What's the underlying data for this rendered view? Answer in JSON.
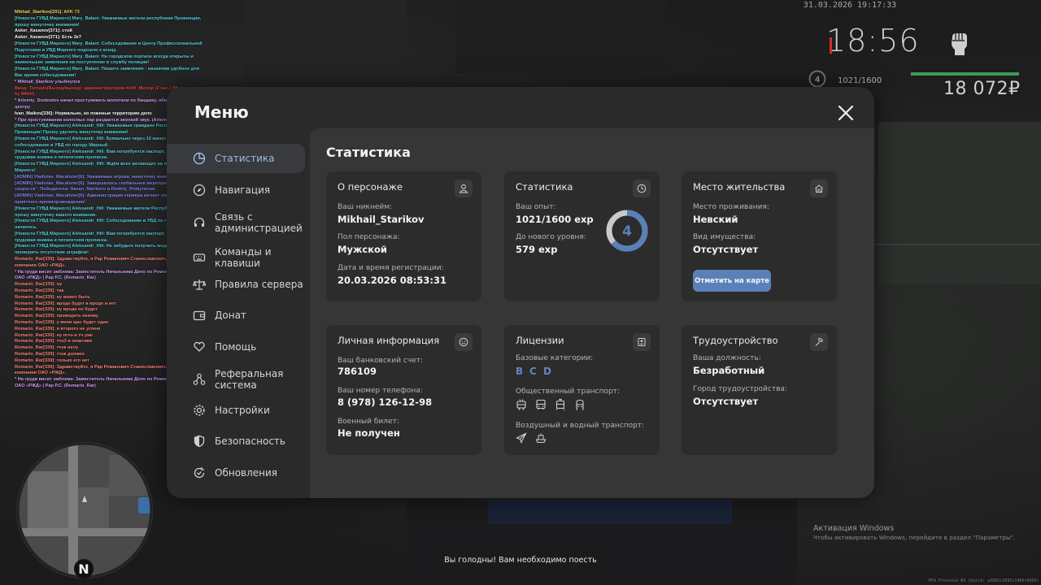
{
  "chat": [
    {
      "text": "Mikhail_Starikov[201]: AFK 73",
      "color": "#e8e05c"
    },
    {
      "text": "[Новости ГУВД Мирного] Mary_Balani: Уважаемые жители республики Провинции, прошу минуточку внимания!",
      "color": "#56d8e6"
    },
    {
      "text": "Asker_Xasanov[371]: стой",
      "color": "#ffffff"
    },
    {
      "text": "Asker_Xasanov[371]: Есть 2к?",
      "color": "#ffffff"
    },
    {
      "text": "[Новости ГУВД Мирного] Mary_Balani: Собеседование в Центр Профессиональной Подготовки в УВД Мирного подошло к концу.",
      "color": "#56d8e6"
    },
    {
      "text": "[Новости ГУВД Мирного] Mary_Balani: На городском портале всегда открыты и наименьшие заявления на поступление в службу полиции!",
      "color": "#56d8e6"
    },
    {
      "text": "[Новости ГУВД Мирного] Mary_Balani: Пишите заявление - назначим удобное для Вас время собеседования!",
      "color": "#56d8e6"
    },
    {
      "text": "* Mikhail_Starikov улыбнулся",
      "color": "#d6a0ff"
    },
    {
      "text": "Ввод: Tornado(Выход/выход): администратором Kirill_Милор (2 час.) (Музыка и идеи by Mikhl)",
      "color": "#e84a4a"
    },
    {
      "text": "* Artemiy_Svobodov начал простукивать молотком по бандажу, ободу, колесно му центру",
      "color": "#d6a0ff"
    },
    {
      "text": "Ivan_Maikov[336]: Нормально, но пожнные территорию депо",
      "color": "#ffffff"
    },
    {
      "text": "* При простукивании колесных пар раздается звонкий звук. (Artemiy_Svobodov)",
      "color": "#d6a0ff"
    },
    {
      "text": "[Новости ГУВД Мирного] Aleksandr_Hill: Уважаемые граждане Республики Провинции! Прошу уделить минуточку внимания!",
      "color": "#56d8e6"
    },
    {
      "text": "[Новости ГУВД Мирного] Aleksandr_Hill: Буквально через 10 минут состоится собеседование в УВД по городу Мирный.",
      "color": "#56d8e6"
    },
    {
      "text": "[Новости ГУВД Мирного] Aleksandr_Hill: Вам потребуется паспорт, военный билет, трудовая книжка и пятилетняя прописка.",
      "color": "#56d8e6"
    },
    {
      "text": "[Новости ГУВД Мирного] Aleksandr_Hill: Ждём всех желающих на парковке УВД Мирного!",
      "color": "#56d8e6"
    },
    {
      "text": "[ADMIN] Vladislav_Macalister[6]: Уважаемые игроки, минуточку внимания!",
      "color": "#8a8aff"
    },
    {
      "text": "[ADMIN] Vladislav_Macalister[6]: Завершилось глобальное мероприятие \"Дыхание скорости\". Победители: Hasan_Marlboro и Dmitriy_Prokyrorow.",
      "color": "#8a8aff"
    },
    {
      "text": "[ADMIN] Vladislav_Macalister[6]: Администрация сервера желает хорошего времени и приятного времяпровождения!",
      "color": "#8a8aff"
    },
    {
      "text": "[Новости ГУВД Мирного] Aleksandr_Hill: Уважаемые жители Республики Провинции, прошу минуточку вашего внимания.",
      "color": "#56d8e6"
    },
    {
      "text": "[Новости ГУВД Мирного] Aleksandr_Hill: Собеседование в УВД по городу Мирный начилось.",
      "color": "#56d8e6"
    },
    {
      "text": "[Новости ГУВД Мирного] Aleksandr_Hill: Вам потребуется паспорт, военный билет, трудовая книжка и пятилетняя прописка.",
      "color": "#56d8e6"
    },
    {
      "text": "[Новости ГУВД Мирного] Aleksandr_Hill: Не забудьте получить медицинскую карту и проверить отсутствие штрафов!",
      "color": "#56d8e6"
    },
    {
      "text": "Romario_Rar[339]: Здравствуйте, я Рар Романович Станиславович, сотрудник компании ОАО «РЖД».",
      "color": "#ff8a7a"
    },
    {
      "text": "* На груди висит эмблема: Заместитель Начальника Депо по Ремонту | Руководство | ОАО «РЖД» | Рар Р.С. (Romario_Rar)",
      "color": "#d6a0ff"
    },
    {
      "text": "Romario_Rar[339]: ну",
      "color": "#ff8a7a"
    },
    {
      "text": "Romario_Rar[339]: так",
      "color": "#ff8a7a"
    },
    {
      "text": "Romario_Rar[339]: ну может быть",
      "color": "#ff8a7a"
    },
    {
      "text": "Romario_Rar[339]: вроде будет в вроде и нет",
      "color": "#ff8a7a"
    },
    {
      "text": "Romario_Rar[339]: ну вроде не будет",
      "color": "#ff8a7a"
    },
    {
      "text": "Romario_Rar[339]: проводить некому",
      "color": "#ff8a7a"
    },
    {
      "text": "Romario_Rar[339]: у меня щас будет один",
      "color": "#ff8a7a"
    },
    {
      "text": "Romario_Rar[339]: я второго не успею",
      "color": "#ff8a7a"
    },
    {
      "text": "Romario_Rar[339]: ну пгчэ и тч уже",
      "color": "#ff8a7a"
    },
    {
      "text": "Romario_Rar[339]: тчэ3 в неактиве",
      "color": "#ff8a7a"
    },
    {
      "text": "Romario_Rar[339]: тчэк нелу",
      "color": "#ff8a7a"
    },
    {
      "text": "Romario_Rar[339]: тчэк должен",
      "color": "#ff8a7a"
    },
    {
      "text": "Romario_Rar[339]: только его нет",
      "color": "#ff8a7a"
    },
    {
      "text": "Romario_Rar[339]: Здравствуйте, я Рар Романович Станиславович, сотрудник компании ОАО «РЖД».",
      "color": "#ff8a7a"
    },
    {
      "text": "* На груди висит эмблема: Заместитель Начальника Депо по Ремонту | Руководство | ОАО «РЖД» | Рар Р.С. (Romario_Rar)",
      "color": "#d6a0ff"
    }
  ],
  "hud": {
    "datetime": "31.03.2026 19:17:33",
    "time": "18:56",
    "level": "4",
    "exp": "1021/1600",
    "money": "18 072₽"
  },
  "minimap": {
    "north": "N"
  },
  "hunger": "Вы голодны! Вам необходимо поесть",
  "activation": {
    "title": "Активация Windows",
    "subtitle": "Чтобы активировать Windows, перейдите в раздел \"Параметры\"."
  },
  "build": "MTA Province #3 (build: a3895c3895c1466c0660)",
  "menu": {
    "title": "Меню",
    "sidebar": [
      {
        "label": "Статистика",
        "icon": "pie-chart-icon",
        "active": true
      },
      {
        "label": "Навигация",
        "icon": "compass-icon"
      },
      {
        "label": "Связь с администрацией",
        "icon": "headset-icon"
      },
      {
        "label": "Команды и клавиши",
        "icon": "keyboard-icon"
      },
      {
        "label": "Правила сервера",
        "icon": "scales-icon"
      },
      {
        "label": "Донат",
        "icon": "wallet-icon"
      },
      {
        "label": "Помощь",
        "icon": "heart-hand-icon"
      },
      {
        "label": "Реферальная система",
        "icon": "network-icon"
      },
      {
        "label": "Настройки",
        "icon": "gear-icon"
      },
      {
        "label": "Безопасность",
        "icon": "shield-icon"
      },
      {
        "label": "Обновления",
        "icon": "refresh-icon"
      }
    ],
    "content_title": "Статистика",
    "cards": {
      "person": {
        "title": "О персонаже",
        "nick_label": "Ваш никнейм:",
        "nick": "Mikhail_Starikov",
        "gender_label": "Пол персонажа:",
        "gender": "Мужской",
        "reg_label": "Дата и время регистрации:",
        "reg": "20.03.2026 08:53:31"
      },
      "stats": {
        "title": "Статистика",
        "exp_label": "Ваш опыт:",
        "exp": "1021/1600 exp",
        "next_label": "До нового уровня:",
        "next": "579 exp",
        "level": "4",
        "progress": 0.638
      },
      "residence": {
        "title": "Место жительства",
        "place_label": "Место проживания:",
        "place": "Невский",
        "property_label": "Вид имущества:",
        "property": "Отсутствует",
        "button": "Отметить на карте"
      },
      "personal": {
        "title": "Личная информация",
        "bank_label": "Ваш банковский счет:",
        "bank": "786109",
        "phone_label": "Ваш номер телефона:",
        "phone": "8 (978) 126-12-98",
        "military_label": "Военный билет:",
        "military": "Не получен"
      },
      "licenses": {
        "title": "Лицензии",
        "base_label": "Базовые категории:",
        "categories": [
          "B",
          "C",
          "D"
        ],
        "public_label": "Общественный транспорт:",
        "public_icons": [
          "trolleybus-icon",
          "bus-icon",
          "tram-icon",
          "metro-icon"
        ],
        "air_label": "Воздушный и водный транспорт:",
        "air_icons": [
          "plane-icon",
          "ship-icon"
        ]
      },
      "job": {
        "title": "Трудоустройство",
        "position_label": "Ваша должность:",
        "position": "Безработный",
        "city_label": "Город трудоустройства:",
        "city": "Отсутствует"
      }
    }
  },
  "colors": {
    "accent": "#5a80b8",
    "active_text": "#9dbbe6",
    "panel": "#2a2a2a",
    "content": "#363636",
    "card": "#2c2c2c"
  }
}
